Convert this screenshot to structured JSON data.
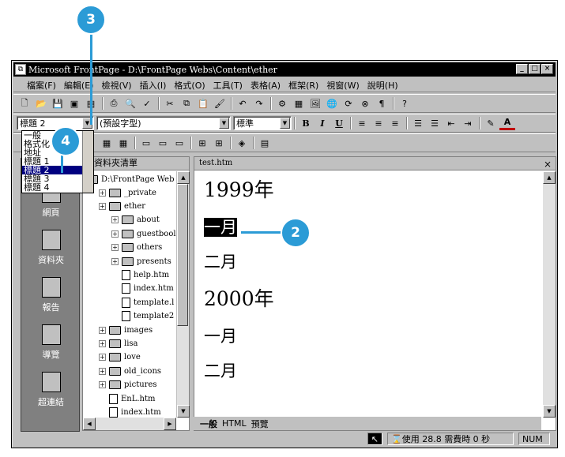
{
  "window": {
    "title": "Microsoft FrontPage - D:\\FrontPage Webs\\Content\\ether",
    "min": "_",
    "max": "□",
    "close": "×"
  },
  "menu": [
    "檔案(F)",
    "編輯(E)",
    "檢視(V)",
    "插入(I)",
    "格式(O)",
    "工具(T)",
    "表格(A)",
    "框架(R)",
    "視窗(W)",
    "說明(H)"
  ],
  "format_toolbar": {
    "style_value": "標題 2",
    "font_value": "(預設字型)",
    "size_value": "標準",
    "bold": "B",
    "italic": "I",
    "underline": "U"
  },
  "style_dropdown": {
    "options": [
      "一般",
      "格式化",
      "地址",
      "標題 1",
      "標題 2",
      "標題 3",
      "標題 4"
    ],
    "selected_index": 4
  },
  "views": [
    "網頁",
    "資料夾",
    "報告",
    "導覽",
    "超連結"
  ],
  "folder_pane": {
    "title": "資料夾清單",
    "root": "D:\\FrontPage Web",
    "nodes": [
      {
        "label": "_private",
        "type": "folder",
        "level": 1
      },
      {
        "label": "ether",
        "type": "folder",
        "level": 1
      },
      {
        "label": "about",
        "type": "folder",
        "level": 2
      },
      {
        "label": "guestbool",
        "type": "folder",
        "level": 2
      },
      {
        "label": "others",
        "type": "folder",
        "level": 2
      },
      {
        "label": "presents",
        "type": "folder",
        "level": 2
      },
      {
        "label": "help.htm",
        "type": "file",
        "level": 2
      },
      {
        "label": "index.htm",
        "type": "file",
        "level": 2
      },
      {
        "label": "template.l",
        "type": "file",
        "level": 2
      },
      {
        "label": "template2",
        "type": "file",
        "level": 2
      },
      {
        "label": "images",
        "type": "folder",
        "level": 1
      },
      {
        "label": "lisa",
        "type": "folder",
        "level": 1
      },
      {
        "label": "love",
        "type": "folder",
        "level": 1
      },
      {
        "label": "old_icons",
        "type": "folder",
        "level": 1
      },
      {
        "label": "pictures",
        "type": "folder",
        "level": 1
      },
      {
        "label": "EnL.htm",
        "type": "file",
        "level": 1
      },
      {
        "label": "index.htm",
        "type": "file",
        "level": 1
      }
    ]
  },
  "editor": {
    "filename": "test.htm",
    "lines": [
      {
        "text": "1999年",
        "style": "h1"
      },
      {
        "text": "一月",
        "style": "h2",
        "selected": true
      },
      {
        "text": "二月",
        "style": "h2"
      },
      {
        "text": "2000年",
        "style": "h1"
      },
      {
        "text": "一月",
        "style": "h2"
      },
      {
        "text": "二月",
        "style": "h2"
      }
    ]
  },
  "view_tabs": [
    "一般",
    "HTML",
    "預覽"
  ],
  "status": {
    "time_text": "使用 28.8 需費時 0 秒",
    "num": "NUM"
  },
  "callouts": [
    "2",
    "3",
    "4"
  ]
}
